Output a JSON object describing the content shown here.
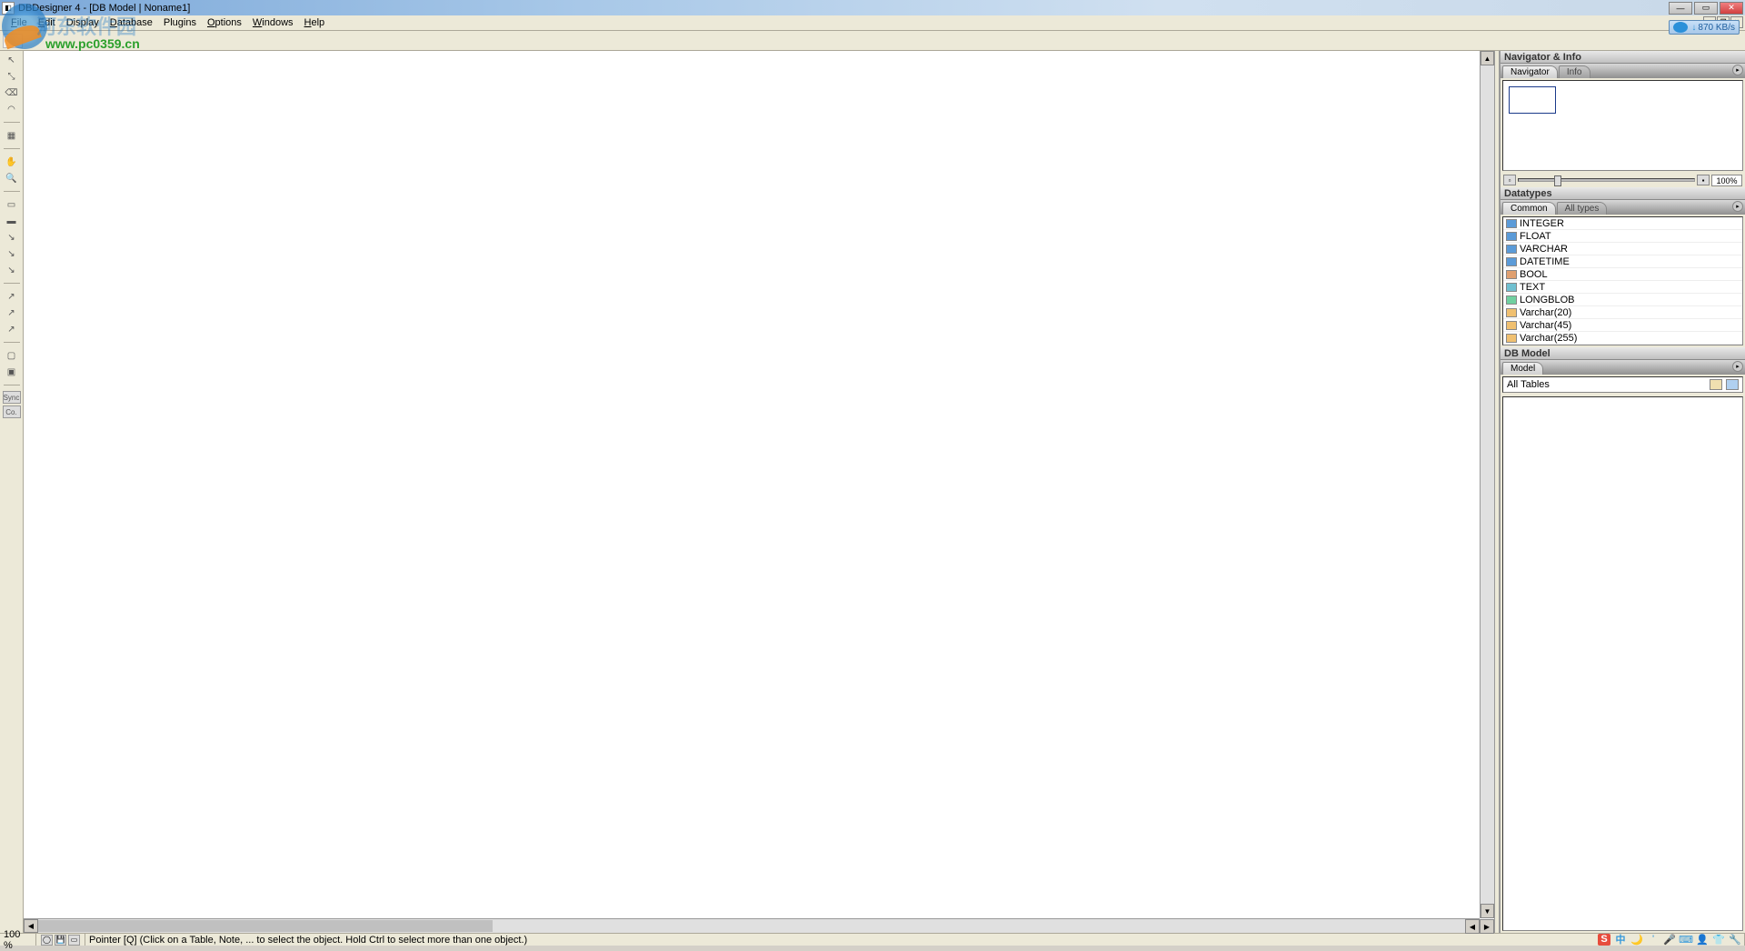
{
  "window": {
    "title": "DBDesigner 4 - [DB Model | Noname1]",
    "download_speed": "870 KB/s"
  },
  "watermark": {
    "text": "河东软件园",
    "url": "www.pc0359.cn"
  },
  "menu": {
    "file": "File",
    "edit": "Edit",
    "display": "Display",
    "database": "Database",
    "plugins": "Plugins",
    "options": "Options",
    "windows": "Windows",
    "help": "Help"
  },
  "panels": {
    "navigator_info": {
      "title": "Navigator & Info",
      "tab_navigator": "Navigator",
      "tab_info": "Info",
      "zoom_value": "100%"
    },
    "datatypes": {
      "title": "Datatypes",
      "tab_common": "Common",
      "tab_alltypes": "All types",
      "items": [
        "INTEGER",
        "FLOAT",
        "VARCHAR",
        "DATETIME",
        "BOOL",
        "TEXT",
        "LONGBLOB",
        "Varchar(20)",
        "Varchar(45)",
        "Varchar(255)"
      ]
    },
    "dbmodel": {
      "title": "DB Model",
      "tab_model": "Model",
      "all_tables": "All Tables"
    }
  },
  "status": {
    "zoom": "100 %",
    "hint": "Pointer [Q] (Click on a Table, Note, ... to select the object. Hold Ctrl to select more than one object.)"
  },
  "tools": {
    "labels": [
      "Sync",
      "Co."
    ]
  }
}
